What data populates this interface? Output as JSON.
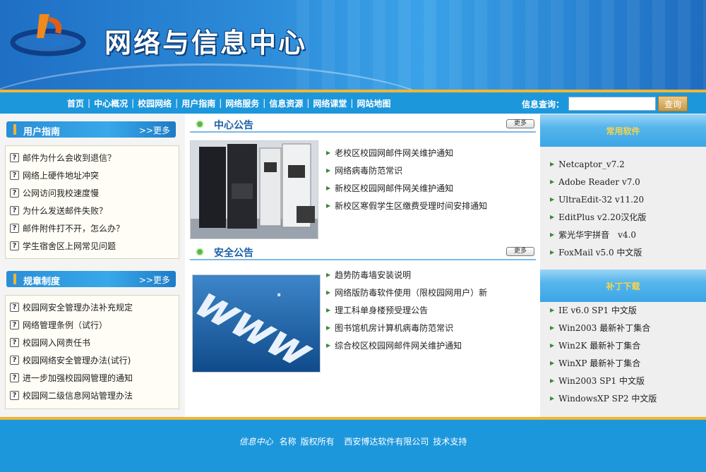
{
  "header": {
    "site_title": "网络与信息中心"
  },
  "nav": {
    "items": [
      "首页",
      "中心概况",
      "校园网络",
      "用户指南",
      "网络服务",
      "信息资源",
      "网络课堂",
      "网站地图"
    ],
    "separator": "|",
    "search_label": "信息查询：",
    "search_value": "",
    "search_button": "查询"
  },
  "user_guide": {
    "title": "用户指南",
    "more": ">>更多",
    "items": [
      "邮件为什么会收到退信？",
      "网络上硬件地址冲突",
      "公网访问我校速度慢",
      "为什么发送邮件失败？",
      "邮件附件打不开，怎么办？",
      "学生宿舍区上网常见问题"
    ]
  },
  "regulations": {
    "title": "规章制度",
    "more": ">>更多",
    "items": [
      "校园网安全管理办法补充规定",
      "网络管理条例（试行）",
      "校园网入网责任书",
      "校园网络安全管理办法(试行)",
      "进一步加强校园网管理的通知",
      "校园网二级信息网站管理办法"
    ]
  },
  "center_notice": {
    "title": "中心公告",
    "more": "更多",
    "items": [
      "老校区校园网邮件网关维护通知",
      "网络病毒防范常识",
      "新校区校园网邮件网关维护通知",
      "新校区寒假学生区缴费受理时间安排通知"
    ]
  },
  "security_notice": {
    "title": "安全公告",
    "more": "更多",
    "items": [
      "趋势防毒墙安装说明",
      "网络版防毒软件使用（限校园网用户）新",
      "理工科单身楼预受理公告",
      "图书馆机房计算机病毒防范常识",
      "综合校区校园网邮件网关维护通知"
    ]
  },
  "software": {
    "title": "常用软件",
    "items": [
      "Netcaptor_v7.2",
      "Adobe Reader v7.0",
      "UltraEdit-32 v11.20",
      "EditPlus v2.20汉化版",
      "紫光华宇拼音　v4.0",
      "FoxMail v5.0 中文版"
    ]
  },
  "patches": {
    "title": "补丁下载",
    "items": [
      "IE v6.0 SP1 中文版",
      "Win2003 最新补丁集合",
      "Win2K 最新补丁集合",
      "WinXP 最新补丁集合",
      "Win2003 SP1 中文版",
      "WindowsXP SP2 中文版"
    ]
  },
  "footer": {
    "org": "信息中心",
    "name_label": "名称",
    "rights": "版权所有",
    "company": "西安博达软件有限公司",
    "support": "技术支持"
  },
  "colors": {
    "nav_blue": "#1d97dc",
    "accent_gold": "#f2b531",
    "heading_blue": "#1b5fa8"
  },
  "icons": {
    "logo": "center-logo",
    "question": "question-icon",
    "bullet": "green-dot-icon",
    "arrow": "triangle-arrow-icon"
  }
}
